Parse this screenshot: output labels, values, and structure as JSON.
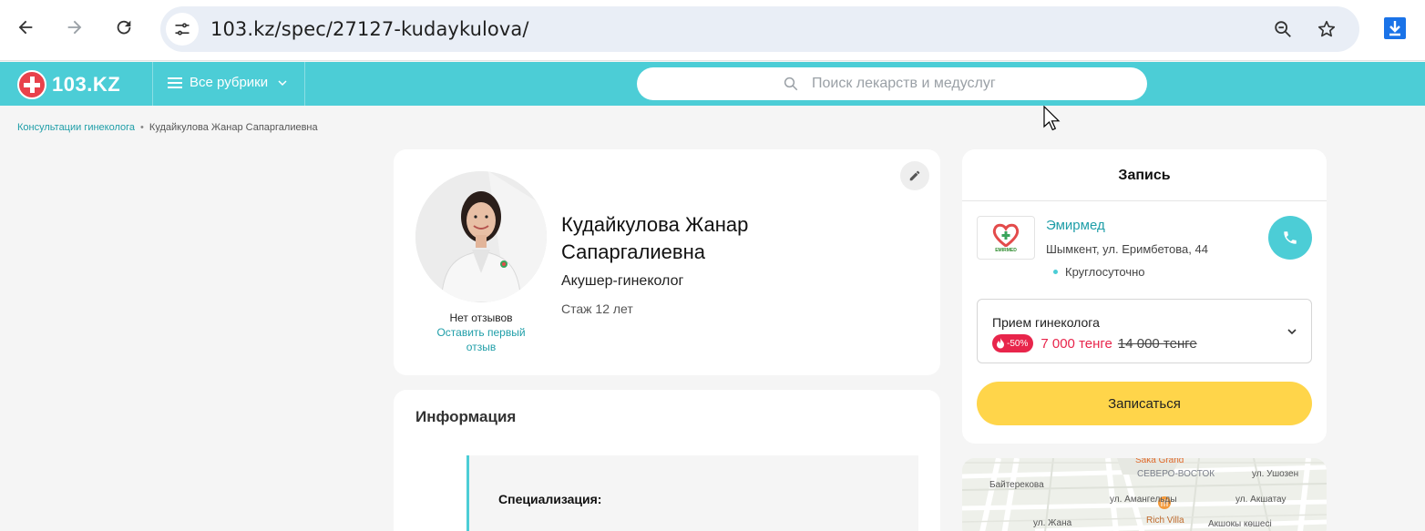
{
  "browser": {
    "url": "103.kz/spec/27127-kudaykulova/",
    "icons": [
      "back-arrow-icon",
      "forward-arrow-icon",
      "reload-icon",
      "tune-icon",
      "zoom-icon",
      "star-icon",
      "download-icon"
    ]
  },
  "site": {
    "logo_text": "103.KZ",
    "rubrics_label": "Все рубрики",
    "search_placeholder": "Поиск лекарств и медуслуг",
    "accent_color": "#4ccdd6",
    "brand_red": "#e8414b"
  },
  "breadcrumb": {
    "items": [
      "Консультации гинеколога",
      "Кудайкулова Жанар Сапаргалиевна"
    ]
  },
  "profile": {
    "name": "Кудайкулова Жанар Сапаргалиевна",
    "specialty": "Акушер-гинеколог",
    "experience": "Стаж 12 лет",
    "reviews_status": "Нет отзывов",
    "leave_review_link": "Оставить первый отзыв"
  },
  "info": {
    "title": "Информация",
    "specialization_label": "Специализация:"
  },
  "booking": {
    "title": "Запись",
    "clinic": {
      "name": "Эмирмед",
      "logo_text": "EMIRMED",
      "address": "Шымкент, ул. Еримбетова, 44",
      "hours": "Круглосуточно"
    },
    "service": {
      "name": "Прием гинеколога",
      "discount": "-50%",
      "price_new": "7 000 тенге",
      "price_old": "14 000 тенге"
    },
    "book_button": "Записаться",
    "button_color": "#ffd54a",
    "price_color": "#e8254b"
  },
  "map": {
    "labels": [
      "Saka Grand",
      "СЕВЕРО-ВОСТОК",
      "ул. Ушозен",
      "ул. Акшатау",
      "Rich Villa",
      "Акшокы көшесі",
      "ул. Жана",
      "ул. Амангельды",
      "Байтерекова"
    ]
  }
}
